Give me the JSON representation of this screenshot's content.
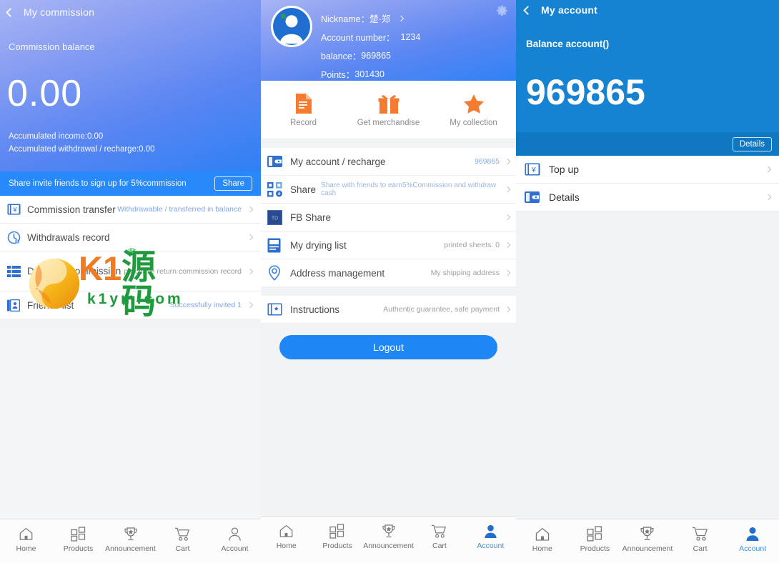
{
  "colors": {
    "brand_blue": "#2889fb",
    "hero_blue_light": "#a9b6f5",
    "hero_blue_dark": "#2e80f5",
    "solid_blue": "#1583d2",
    "details_bar": "#1077c2",
    "orange_accent": "#f47b30",
    "link_blue": "#7fa6e8",
    "tab_active": "#3f8fe0"
  },
  "panel1": {
    "nav": {
      "back_icon": "chevron-left-icon",
      "title": "My commission"
    },
    "balance_label": "Commission balance",
    "amount": "0.00",
    "accumulated_income": "Accumulated income:0.00",
    "accumulated_withdrawal": "Accumulated withdrawal / recharge:0.00",
    "share_banner": {
      "text": "Share invite friends to sign up for 5%commission",
      "button": "Share"
    },
    "rows": [
      {
        "icon": "ticket-yen-icon",
        "label": "Commission transfer",
        "meta": "Withdrawable / transferred in balance",
        "meta_style": "link"
      },
      {
        "icon": "clock-history-icon",
        "label": "Withdrawals record",
        "meta": "",
        "meta_style": "link"
      },
      {
        "icon": "grid-list-icon",
        "label": "Details of commission",
        "meta": "purchase return commission record",
        "meta_style": "gray"
      },
      {
        "icon": "contact-book-icon",
        "label": "Friends list",
        "meta": "Successfully invited 1",
        "meta_style": "link"
      }
    ],
    "watermark": {
      "brand_latin": "K1",
      "brand_cn": "源码",
      "domain": "k1ym.com"
    },
    "tabbar": [
      {
        "icon": "home-icon",
        "label": "Home",
        "active": false
      },
      {
        "icon": "grid-products-icon",
        "label": "Products",
        "active": false
      },
      {
        "icon": "trophy-announcement-icon",
        "label": "Announcement",
        "active": false
      },
      {
        "icon": "cart-icon",
        "label": "Cart",
        "active": false
      },
      {
        "icon": "user-account-icon",
        "label": "Account",
        "active": false
      }
    ]
  },
  "panel2": {
    "gear_icon": "gear-icon",
    "avatar_icon": "avatar-placeholder-icon",
    "profile": {
      "nickname_label": "Nickname：",
      "nickname_value": "楚·郑",
      "account_label": "Account number：",
      "account_value": "1234",
      "balance_label": "balance：",
      "balance_value": "969865",
      "points_label": "Points：",
      "points_value": "301430"
    },
    "actions": [
      {
        "icon": "document-record-icon",
        "label": "Record"
      },
      {
        "icon": "gift-icon",
        "label": "Get merchandise"
      },
      {
        "icon": "star-icon",
        "label": "My collection"
      }
    ],
    "rows": [
      {
        "icon": "wallet-icon",
        "label": "My account / recharge",
        "inline_sub": "",
        "meta": "969865",
        "meta_style": "link"
      },
      {
        "icon": "qrcode-share-icon",
        "label": "Share",
        "inline_sub": "Share with friends to earn5%Commission and withdraw cash",
        "meta": "",
        "meta_style": "link"
      },
      {
        "icon": "fb-share-icon",
        "label": "FB Share",
        "inline_sub": "",
        "meta": "",
        "meta_style": "gray"
      },
      {
        "icon": "document-list-icon",
        "label": "My drying list",
        "inline_sub": "",
        "meta": "printed sheets: 0",
        "meta_style": "gray"
      },
      {
        "icon": "location-pin-icon",
        "label": "Address management",
        "inline_sub": "",
        "meta": "My shipping address",
        "meta_style": "gray"
      }
    ],
    "rows2": [
      {
        "icon": "instructions-icon",
        "label": "Instructions",
        "inline_sub": "",
        "meta": "Authentic guarantee, safe payment",
        "meta_style": "gray"
      }
    ],
    "logout_label": "Logout",
    "tabbar": [
      {
        "icon": "home-icon",
        "label": "Home",
        "active": false
      },
      {
        "icon": "grid-products-icon",
        "label": "Products",
        "active": false
      },
      {
        "icon": "trophy-announcement-icon",
        "label": "Announcement",
        "active": false
      },
      {
        "icon": "cart-icon",
        "label": "Cart",
        "active": false
      },
      {
        "icon": "user-account-icon",
        "label": "Account",
        "active": true
      }
    ]
  },
  "panel3": {
    "nav": {
      "back_icon": "chevron-left-icon",
      "title": "My account"
    },
    "balance_label": "Balance account()",
    "amount": "969865",
    "details_button": "Details",
    "rows": [
      {
        "icon": "ticket-yen-icon",
        "label": "Top up"
      },
      {
        "icon": "wallet-icon",
        "label": "Details"
      }
    ],
    "tabbar": [
      {
        "icon": "home-icon",
        "label": "Home",
        "active": false
      },
      {
        "icon": "grid-products-icon",
        "label": "Products",
        "active": false
      },
      {
        "icon": "trophy-announcement-icon",
        "label": "Announcement",
        "active": false
      },
      {
        "icon": "cart-icon",
        "label": "Cart",
        "active": false
      },
      {
        "icon": "user-account-icon",
        "label": "Account",
        "active": true
      }
    ]
  }
}
